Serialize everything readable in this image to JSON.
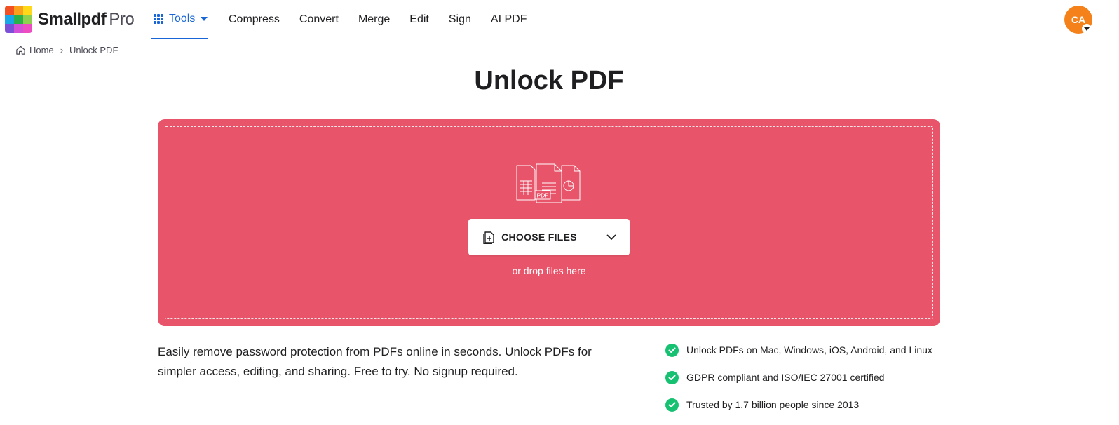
{
  "brand": {
    "name": "Smallpdf",
    "tier": "Pro",
    "logo_colors": [
      "#f25022",
      "#f9a11b",
      "#ffd81a",
      "#1aa7e8",
      "#2bb14a",
      "#8fd14f",
      "#7b4fd8",
      "#d34fd8",
      "#ee4dc2"
    ]
  },
  "nav": {
    "tools_label": "Tools",
    "items": [
      "Compress",
      "Convert",
      "Merge",
      "Edit",
      "Sign",
      "AI PDF"
    ]
  },
  "user": {
    "initials": "CA",
    "avatar_color": "#f48119"
  },
  "breadcrumb": {
    "home": "Home",
    "current": "Unlock PDF"
  },
  "page": {
    "title": "Unlock PDF"
  },
  "dropzone": {
    "color": "#e8546a",
    "choose_label": "CHOOSE FILES",
    "hint": "or drop files here",
    "illustration_badge": "PDF"
  },
  "description": "Easily remove password protection from PDFs online in seconds. Unlock PDFs for simpler access, editing, and sharing. Free to try. No signup required.",
  "features": [
    "Unlock PDFs on Mac, Windows, iOS, Android, and Linux",
    "GDPR compliant and ISO/IEC 27001 certified",
    "Trusted by 1.7 billion people since 2013"
  ],
  "colors": {
    "accent": "#1765d6",
    "check": "#16c172"
  }
}
